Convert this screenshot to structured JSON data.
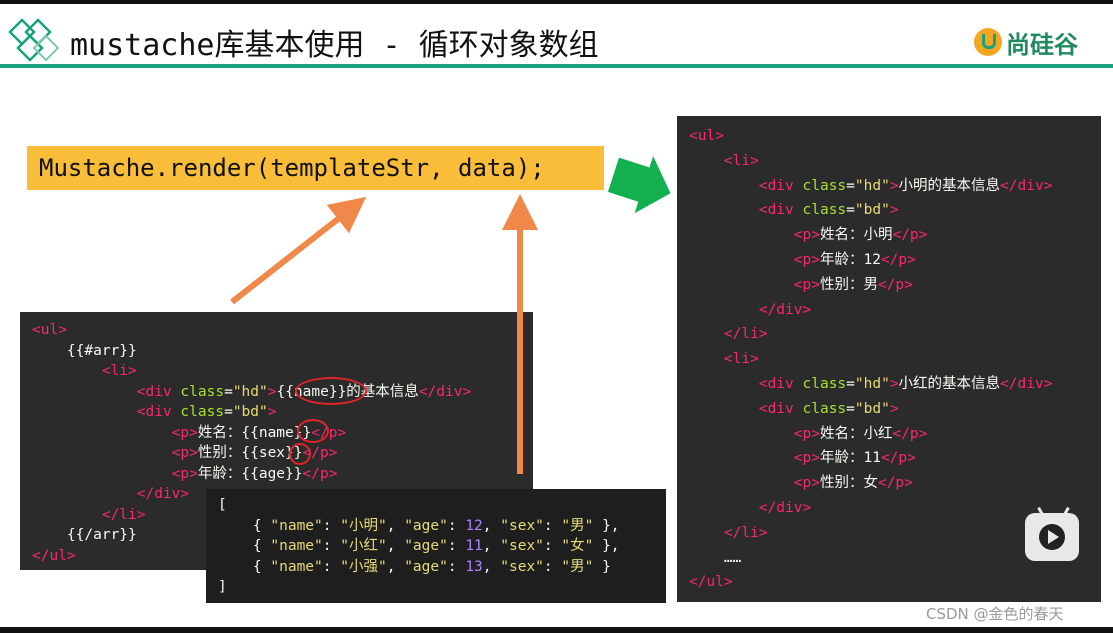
{
  "header": {
    "title": "mustache库基本使用 - 循环对象数组",
    "brand": "尚硅谷"
  },
  "render_call": "Mustache.render(templateStr, data);",
  "template_lines": [
    [
      {
        "t": "tag",
        "v": "<ul>"
      }
    ],
    [
      {
        "t": "plain",
        "v": "    {{#arr}}"
      }
    ],
    [
      {
        "t": "plain",
        "v": "        "
      },
      {
        "t": "tag",
        "v": "<li>"
      }
    ],
    [
      {
        "t": "plain",
        "v": "            "
      },
      {
        "t": "tag",
        "v": "<div "
      },
      {
        "t": "attr",
        "v": "class"
      },
      {
        "t": "plain",
        "v": "="
      },
      {
        "t": "str",
        "v": "\"hd\""
      },
      {
        "t": "tag",
        "v": ">"
      },
      {
        "t": "plain",
        "v": "{{name}}的基本信息"
      },
      {
        "t": "tag",
        "v": "</div>"
      }
    ],
    [
      {
        "t": "plain",
        "v": "            "
      },
      {
        "t": "tag",
        "v": "<div "
      },
      {
        "t": "attr",
        "v": "class"
      },
      {
        "t": "plain",
        "v": "="
      },
      {
        "t": "str",
        "v": "\"bd\""
      },
      {
        "t": "tag",
        "v": ">"
      }
    ],
    [
      {
        "t": "plain",
        "v": "                "
      },
      {
        "t": "tag",
        "v": "<p>"
      },
      {
        "t": "plain",
        "v": "姓名：{{name}}"
      },
      {
        "t": "tag",
        "v": "</p>"
      }
    ],
    [
      {
        "t": "plain",
        "v": "                "
      },
      {
        "t": "tag",
        "v": "<p>"
      },
      {
        "t": "plain",
        "v": "性别：{{sex}}"
      },
      {
        "t": "tag",
        "v": "</p>"
      }
    ],
    [
      {
        "t": "plain",
        "v": "                "
      },
      {
        "t": "tag",
        "v": "<p>"
      },
      {
        "t": "plain",
        "v": "年龄：{{age}}"
      },
      {
        "t": "tag",
        "v": "</p>"
      }
    ],
    [
      {
        "t": "plain",
        "v": "            "
      },
      {
        "t": "tag",
        "v": "</div>"
      }
    ],
    [
      {
        "t": "plain",
        "v": "        "
      },
      {
        "t": "tag",
        "v": "</li>"
      }
    ],
    [
      {
        "t": "plain",
        "v": "    {{/arr}}"
      }
    ],
    [
      {
        "t": "tag",
        "v": "</ul>"
      }
    ]
  ],
  "data_lines": [
    [
      {
        "t": "plain",
        "v": "["
      }
    ],
    [
      {
        "t": "plain",
        "v": "    { "
      },
      {
        "t": "str",
        "v": "\"name\""
      },
      {
        "t": "plain",
        "v": ": "
      },
      {
        "t": "str",
        "v": "\"小明\""
      },
      {
        "t": "plain",
        "v": ", "
      },
      {
        "t": "str",
        "v": "\"age\""
      },
      {
        "t": "plain",
        "v": ": "
      },
      {
        "t": "num",
        "v": "12"
      },
      {
        "t": "plain",
        "v": ", "
      },
      {
        "t": "str",
        "v": "\"sex\""
      },
      {
        "t": "plain",
        "v": ": "
      },
      {
        "t": "str",
        "v": "\"男\""
      },
      {
        "t": "plain",
        "v": " },"
      }
    ],
    [
      {
        "t": "plain",
        "v": "    { "
      },
      {
        "t": "str",
        "v": "\"name\""
      },
      {
        "t": "plain",
        "v": ": "
      },
      {
        "t": "str",
        "v": "\"小红\""
      },
      {
        "t": "plain",
        "v": ", "
      },
      {
        "t": "str",
        "v": "\"age\""
      },
      {
        "t": "plain",
        "v": ": "
      },
      {
        "t": "num",
        "v": "11"
      },
      {
        "t": "plain",
        "v": ", "
      },
      {
        "t": "str",
        "v": "\"sex\""
      },
      {
        "t": "plain",
        "v": ": "
      },
      {
        "t": "str",
        "v": "\"女\""
      },
      {
        "t": "plain",
        "v": " },"
      }
    ],
    [
      {
        "t": "plain",
        "v": "    { "
      },
      {
        "t": "str",
        "v": "\"name\""
      },
      {
        "t": "plain",
        "v": ": "
      },
      {
        "t": "str",
        "v": "\"小强\""
      },
      {
        "t": "plain",
        "v": ", "
      },
      {
        "t": "str",
        "v": "\"age\""
      },
      {
        "t": "plain",
        "v": ": "
      },
      {
        "t": "num",
        "v": "13"
      },
      {
        "t": "plain",
        "v": ", "
      },
      {
        "t": "str",
        "v": "\"sex\""
      },
      {
        "t": "plain",
        "v": ": "
      },
      {
        "t": "str",
        "v": "\"男\""
      },
      {
        "t": "plain",
        "v": " }"
      }
    ],
    [
      {
        "t": "plain",
        "v": "]"
      }
    ]
  ],
  "result_lines": [
    [
      {
        "t": "tag",
        "v": "<ul>"
      }
    ],
    [
      {
        "t": "plain",
        "v": "    "
      },
      {
        "t": "tag",
        "v": "<li>"
      }
    ],
    [
      {
        "t": "plain",
        "v": "        "
      },
      {
        "t": "tag",
        "v": "<div "
      },
      {
        "t": "attr",
        "v": "class"
      },
      {
        "t": "plain",
        "v": "="
      },
      {
        "t": "str",
        "v": "\"hd\""
      },
      {
        "t": "tag",
        "v": ">"
      },
      {
        "t": "plain",
        "v": "小明的基本信息"
      },
      {
        "t": "tag",
        "v": "</div>"
      }
    ],
    [
      {
        "t": "plain",
        "v": "        "
      },
      {
        "t": "tag",
        "v": "<div "
      },
      {
        "t": "attr",
        "v": "class"
      },
      {
        "t": "plain",
        "v": "="
      },
      {
        "t": "str",
        "v": "\"bd\""
      },
      {
        "t": "tag",
        "v": ">"
      }
    ],
    [
      {
        "t": "plain",
        "v": "            "
      },
      {
        "t": "tag",
        "v": "<p>"
      },
      {
        "t": "plain",
        "v": "姓名：小明"
      },
      {
        "t": "tag",
        "v": "</p>"
      }
    ],
    [
      {
        "t": "plain",
        "v": "            "
      },
      {
        "t": "tag",
        "v": "<p>"
      },
      {
        "t": "plain",
        "v": "年龄：12"
      },
      {
        "t": "tag",
        "v": "</p>"
      }
    ],
    [
      {
        "t": "plain",
        "v": "            "
      },
      {
        "t": "tag",
        "v": "<p>"
      },
      {
        "t": "plain",
        "v": "性别：男"
      },
      {
        "t": "tag",
        "v": "</p>"
      }
    ],
    [
      {
        "t": "plain",
        "v": "        "
      },
      {
        "t": "tag",
        "v": "</div>"
      }
    ],
    [
      {
        "t": "plain",
        "v": "    "
      },
      {
        "t": "tag",
        "v": "</li>"
      }
    ],
    [
      {
        "t": "plain",
        "v": "    "
      },
      {
        "t": "tag",
        "v": "<li>"
      }
    ],
    [
      {
        "t": "plain",
        "v": "        "
      },
      {
        "t": "tag",
        "v": "<div "
      },
      {
        "t": "attr",
        "v": "class"
      },
      {
        "t": "plain",
        "v": "="
      },
      {
        "t": "str",
        "v": "\"hd\""
      },
      {
        "t": "tag",
        "v": ">"
      },
      {
        "t": "plain",
        "v": "小红的基本信息"
      },
      {
        "t": "tag",
        "v": "</div>"
      }
    ],
    [
      {
        "t": "plain",
        "v": "        "
      },
      {
        "t": "tag",
        "v": "<div "
      },
      {
        "t": "attr",
        "v": "class"
      },
      {
        "t": "plain",
        "v": "="
      },
      {
        "t": "str",
        "v": "\"bd\""
      },
      {
        "t": "tag",
        "v": ">"
      }
    ],
    [
      {
        "t": "plain",
        "v": "            "
      },
      {
        "t": "tag",
        "v": "<p>"
      },
      {
        "t": "plain",
        "v": "姓名：小红"
      },
      {
        "t": "tag",
        "v": "</p>"
      }
    ],
    [
      {
        "t": "plain",
        "v": "            "
      },
      {
        "t": "tag",
        "v": "<p>"
      },
      {
        "t": "plain",
        "v": "年龄：11"
      },
      {
        "t": "tag",
        "v": "</p>"
      }
    ],
    [
      {
        "t": "plain",
        "v": "            "
      },
      {
        "t": "tag",
        "v": "<p>"
      },
      {
        "t": "plain",
        "v": "性别：女"
      },
      {
        "t": "tag",
        "v": "</p>"
      }
    ],
    [
      {
        "t": "plain",
        "v": "        "
      },
      {
        "t": "tag",
        "v": "</div>"
      }
    ],
    [
      {
        "t": "plain",
        "v": "    "
      },
      {
        "t": "tag",
        "v": "</li>"
      }
    ],
    [
      {
        "t": "plain",
        "v": "    ……"
      }
    ],
    [
      {
        "t": "tag",
        "v": "</ul>"
      }
    ]
  ],
  "watermark": "CSDN @金色的春天",
  "colors": {
    "accent_green": "#1aa37a",
    "render_bg": "#f9bd3a",
    "arrow_orange": "#f0884a",
    "arrow_green": "#12b04f"
  },
  "icons": {
    "logo": "diamond-logo-icon",
    "video": "play-button-icon"
  }
}
